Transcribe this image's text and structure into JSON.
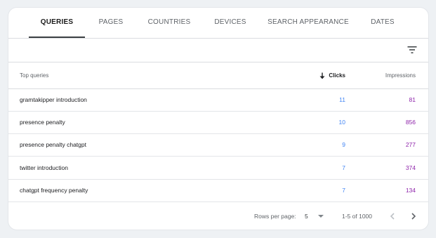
{
  "tabs": [
    {
      "label": "QUERIES",
      "active": true
    },
    {
      "label": "PAGES",
      "active": false
    },
    {
      "label": "COUNTRIES",
      "active": false
    },
    {
      "label": "DEVICES",
      "active": false
    },
    {
      "label": "SEARCH APPEARANCE",
      "active": false
    },
    {
      "label": "DATES",
      "active": false
    }
  ],
  "toolbar": {
    "filter_icon": "filter-icon"
  },
  "table": {
    "headers": {
      "query": "Top queries",
      "clicks": "Clicks",
      "impressions": "Impressions"
    },
    "sort": {
      "column": "clicks",
      "direction": "descending",
      "icon": "arrow-down-icon"
    },
    "rows": [
      {
        "query": "gramtakipper introduction",
        "clicks": "11",
        "impressions": "81"
      },
      {
        "query": "presence penalty",
        "clicks": "10",
        "impressions": "856"
      },
      {
        "query": "presence penalty chatgpt",
        "clicks": "9",
        "impressions": "277"
      },
      {
        "query": "twitter introduction",
        "clicks": "7",
        "impressions": "374"
      },
      {
        "query": "chatgpt frequency penalty",
        "clicks": "7",
        "impressions": "134"
      }
    ]
  },
  "pagination": {
    "rows_per_page_label": "Rows per page:",
    "rows_per_page_value": "5",
    "range": "1-5 of 1000",
    "prev_icon": "chevron-left-icon",
    "next_icon": "chevron-right-icon"
  },
  "colors": {
    "clicks": "#4285f4",
    "impressions": "#8e24aa",
    "active_tab": "#3c4043"
  }
}
